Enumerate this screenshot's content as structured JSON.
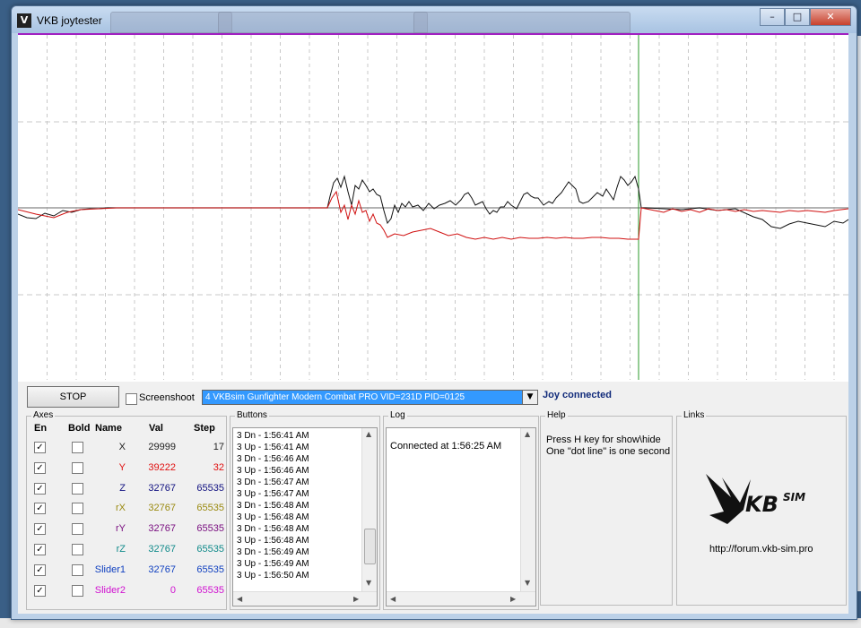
{
  "window": {
    "title": "VKB joytester",
    "tabs": [
      "",
      "",
      ""
    ]
  },
  "controls": {
    "stop_label": "STOP",
    "screenshot_label": "Screenshoot",
    "device": "4 VKBsim Gunfighter Modern Combat PRO  VID=231D PID=0125",
    "status": "Joy connected"
  },
  "axes": {
    "group_label": "Axes",
    "headers": {
      "en": "En",
      "bold": "Bold",
      "name": "Name",
      "val": "Val",
      "step": "Step"
    },
    "rows": [
      {
        "name": "X",
        "val": "29999",
        "step": "17",
        "color": "#222222",
        "en": true
      },
      {
        "name": "Y",
        "val": "39222",
        "step": "32",
        "color": "#e01010",
        "en": true
      },
      {
        "name": "Z",
        "val": "32767",
        "step": "65535",
        "color": "#101080",
        "en": true
      },
      {
        "name": "rX",
        "val": "32767",
        "step": "65535",
        "color": "#9a8a10",
        "en": true
      },
      {
        "name": "rY",
        "val": "32767",
        "step": "65535",
        "color": "#7a1080",
        "en": true
      },
      {
        "name": "rZ",
        "val": "32767",
        "step": "65535",
        "color": "#108a8a",
        "en": true
      },
      {
        "name": "Slider1",
        "val": "32767",
        "step": "65535",
        "color": "#1040c0",
        "en": true
      },
      {
        "name": "Slider2",
        "val": "0",
        "step": "65535",
        "color": "#d010d0",
        "en": true
      }
    ]
  },
  "buttons": {
    "group_label": "Buttons",
    "lines": [
      "3 Dn - 1:56:41 AM",
      "3 Up - 1:56:41 AM",
      "3 Dn - 1:56:46 AM",
      "3 Up - 1:56:46 AM",
      "3 Dn - 1:56:47 AM",
      "3 Up - 1:56:47 AM",
      "3 Dn - 1:56:48 AM",
      "3 Up - 1:56:48 AM",
      "3 Dn - 1:56:48 AM",
      "3 Up - 1:56:48 AM",
      "3 Dn - 1:56:49 AM",
      "3 Up - 1:56:49 AM",
      "3 Up - 1:56:50 AM"
    ]
  },
  "log": {
    "group_label": "Log",
    "text": "Connected at 1:56:25 AM"
  },
  "help": {
    "group_label": "Help",
    "line1": "Press H key for show\\hide",
    "line2": "One \"dot line\" is one second"
  },
  "links": {
    "group_label": "Links",
    "logo_text": "KBSIM",
    "url": "http://forum.vkb-sim.pro"
  },
  "graph": {
    "x_series": [
      0,
      1,
      -1,
      -2,
      -3,
      -4,
      -2,
      0,
      1,
      2,
      1,
      0,
      0,
      0,
      0,
      0,
      0,
      0,
      0,
      0,
      0,
      0,
      0,
      0,
      0,
      0,
      0,
      0,
      0,
      0,
      0,
      0,
      0,
      0,
      0,
      0,
      0,
      0,
      0,
      0,
      0,
      0,
      0,
      0,
      0,
      0,
      0,
      0,
      0,
      0,
      0,
      0,
      0,
      0,
      0,
      0,
      0,
      0,
      0,
      0,
      0,
      0,
      0,
      0,
      0,
      0,
      0,
      0,
      0,
      0,
      0,
      0,
      0,
      0,
      0,
      0,
      0,
      0,
      0,
      0,
      0,
      0,
      0,
      0,
      0,
      0,
      0,
      0,
      0,
      0,
      0,
      0,
      0,
      0,
      0,
      0,
      0,
      0,
      0,
      0,
      0,
      0,
      0,
      0,
      0,
      0,
      0,
      0,
      0,
      0,
      0,
      0,
      0,
      0,
      0,
      0,
      0,
      0,
      0,
      0,
      0,
      0,
      0,
      0,
      0,
      0,
      0,
      0,
      0,
      0,
      0,
      0,
      0,
      0,
      0,
      0,
      0,
      0,
      0,
      0,
      0,
      0,
      0,
      0,
      0,
      0,
      0,
      0,
      0,
      0,
      0,
      0,
      0,
      0,
      0,
      0,
      0,
      0,
      0,
      0,
      0,
      0,
      0,
      0,
      0,
      0,
      0,
      0,
      0,
      0,
      0,
      0,
      0,
      0,
      0,
      0,
      0,
      0,
      0,
      0,
      0,
      0,
      0,
      0,
      0,
      0,
      0,
      0,
      0,
      0,
      0,
      0,
      0,
      0,
      0,
      0,
      0,
      0,
      0,
      0,
      0,
      0,
      0,
      0,
      0,
      0,
      0,
      0,
      0,
      0,
      0,
      0,
      0,
      0,
      0,
      0,
      0,
      0,
      0,
      0,
      0,
      0,
      0,
      0,
      0,
      0,
      0,
      0,
      0,
      0,
      0,
      0,
      0,
      0,
      0,
      0,
      0,
      0,
      0,
      0,
      0,
      0,
      0,
      0,
      0,
      0,
      0,
      0,
      0,
      0,
      0,
      0,
      0,
      0,
      0,
      0,
      0,
      0,
      0
    ],
    "y_series": [
      0
    ]
  }
}
